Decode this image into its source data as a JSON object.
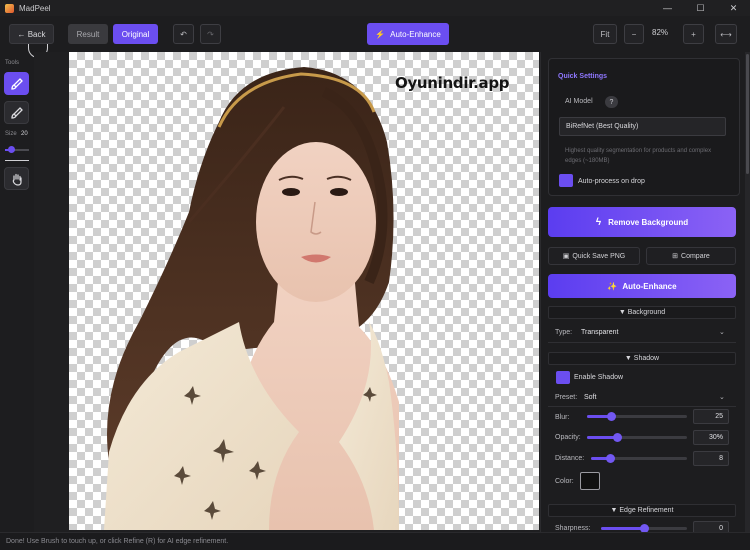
{
  "app": {
    "title": "MadPeel"
  },
  "window": {
    "minimize": "—",
    "maximize": "☐",
    "close": "✕"
  },
  "toolbar": {
    "back_label": "← Back",
    "result_label": "Result",
    "original_label": "Original",
    "undo_icon": "↶",
    "redo_icon": "↷",
    "auto_enhance_label": "Auto-Enhance",
    "fit_label": "Fit",
    "zoom_out_label": "−",
    "zoom_level": "82%",
    "zoom_in_label": "+",
    "expand_icon": "⟷"
  },
  "tools": {
    "label": "Tools",
    "size_label": "Size",
    "size_value": "20",
    "size_fraction": 0.25
  },
  "canvas": {
    "watermark": "Oyunindir.app"
  },
  "panel": {
    "quick_settings_title": "Quick Settings",
    "ai_model_label": "AI Model",
    "help_label": "?",
    "model_value": "BiRefNet (Best Quality)",
    "model_description": "Highest quality segmentation for products and complex edges (~180MB)",
    "auto_process_label": "Auto-process on drop",
    "remove_bg_label": "Remove Background",
    "quick_save_label": "Quick Save PNG",
    "compare_label": "Compare",
    "auto_enhance_label": "Auto-Enhance",
    "background_section": "▼ Background",
    "type_label": "Type:",
    "type_value": "Transparent",
    "shadow_section": "▼ Shadow",
    "enable_shadow_label": "Enable Shadow",
    "preset_label": "Preset:",
    "preset_value": "Soft",
    "blur_label": "Blur:",
    "blur_value": "25",
    "blur_fraction": 0.24,
    "opacity_label": "Opacity:",
    "opacity_value": "30%",
    "opacity_fraction": 0.3,
    "distance_label": "Distance:",
    "distance_value": "8",
    "distance_fraction": 0.2,
    "color_label": "Color:",
    "shadow_color": "#111111",
    "edge_section": "▼ Edge Refinement",
    "sharpness_label": "Sharpness:",
    "sharpness_value": "0",
    "sharpness_fraction": 0.5
  },
  "status": {
    "message": "Done! Use Brush to touch up, or click Refine (R) for AI edge refinement."
  },
  "colors": {
    "accent": "#6b4ef0",
    "panel_bg": "#1d1d1f",
    "canvas_bg": "#1f1f21"
  }
}
